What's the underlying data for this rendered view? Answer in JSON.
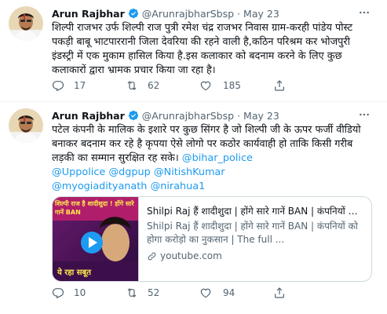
{
  "tweets": [
    {
      "author_name": "Arun Rajbhar",
      "handle": "@ArunrajbharSbsp",
      "time": "May 23",
      "text": "शिल्पी राजभर उर्फ शिल्पी राज पुत्री रमेश चंद्र राजभर निवास ग्राम-करही पांडेय पोस्ट पकड़ी बाबू भाटपाररानी जिला देवरिया की रहने वाली है,कठिन परिश्रम कर भोजपुरी इंडस्ट्री में एक मुकाम हासिल किया है.इस कलाकार को बदनाम करने के लिए कुछ कलाकारों द्वारा भ्रामक प्रचार किया जा रहा है।",
      "replies": "17",
      "retweets": "62",
      "likes": "185"
    },
    {
      "author_name": "Arun Rajbhar",
      "handle": "@ArunrajbharSbsp",
      "time": "May 23",
      "text_main": "पटेल कंपनी के मालिक के इशारे पर कुछ सिंगर है जो शिल्पी जी के ऊपर फर्जी वीडियो बनाकर बदनाम कर रहे है कृपया ऐसे लोगो पर कठोर कार्यवाही हो ताकि किसी गरीब लड़की का सम्मान सुरक्षित रह सके।",
      "mentions": [
        "@bihar_police",
        "@Uppolice",
        "@dgpup",
        "@NitishKumar",
        "@myogiadityanath",
        "@nirahua1"
      ],
      "card": {
        "thumb_top_text": "शिल्पी राज है शादीशुदा ! होंगे सारे गानें BAN",
        "thumb_bottom_text": "ये रहा सबूत",
        "title": "Shilpi Raj हैं शादीशुदा | होंगे सारे गानें BAN | कंपनियों को ...",
        "description": "Shilpi Raj हैं शादीशुदा | होंगे सारे गानें BAN | कंपनियों को होगा करोड़ो का नुकसान | The full ...",
        "domain": "youtube.com"
      },
      "replies": "10",
      "retweets": "52",
      "likes": "94"
    }
  ],
  "colors": {
    "link": "#1d9bf0",
    "secondary_text": "#536471",
    "verified": "#1d9bf0",
    "border": "#cfd9de"
  },
  "icons": [
    "more-icon",
    "verified-badge-icon",
    "reply-icon",
    "retweet-icon",
    "like-icon",
    "share-icon",
    "link-icon",
    "play-icon"
  ]
}
